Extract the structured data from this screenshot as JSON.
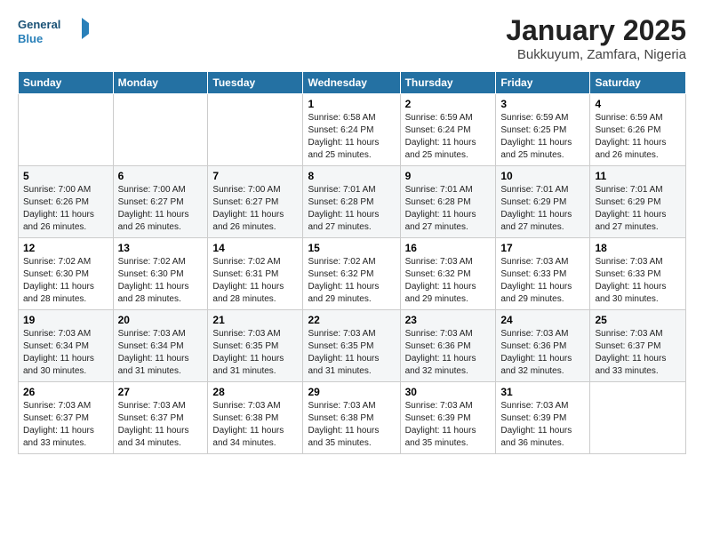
{
  "header": {
    "logo_line1": "General",
    "logo_line2": "Blue",
    "title": "January 2025",
    "subtitle": "Bukkuyum, Zamfara, Nigeria"
  },
  "weekdays": [
    "Sunday",
    "Monday",
    "Tuesday",
    "Wednesday",
    "Thursday",
    "Friday",
    "Saturday"
  ],
  "weeks": [
    [
      {
        "day": "",
        "info": ""
      },
      {
        "day": "",
        "info": ""
      },
      {
        "day": "",
        "info": ""
      },
      {
        "day": "1",
        "info": "Sunrise: 6:58 AM\nSunset: 6:24 PM\nDaylight: 11 hours and 25 minutes."
      },
      {
        "day": "2",
        "info": "Sunrise: 6:59 AM\nSunset: 6:24 PM\nDaylight: 11 hours and 25 minutes."
      },
      {
        "day": "3",
        "info": "Sunrise: 6:59 AM\nSunset: 6:25 PM\nDaylight: 11 hours and 25 minutes."
      },
      {
        "day": "4",
        "info": "Sunrise: 6:59 AM\nSunset: 6:26 PM\nDaylight: 11 hours and 26 minutes."
      }
    ],
    [
      {
        "day": "5",
        "info": "Sunrise: 7:00 AM\nSunset: 6:26 PM\nDaylight: 11 hours and 26 minutes."
      },
      {
        "day": "6",
        "info": "Sunrise: 7:00 AM\nSunset: 6:27 PM\nDaylight: 11 hours and 26 minutes."
      },
      {
        "day": "7",
        "info": "Sunrise: 7:00 AM\nSunset: 6:27 PM\nDaylight: 11 hours and 26 minutes."
      },
      {
        "day": "8",
        "info": "Sunrise: 7:01 AM\nSunset: 6:28 PM\nDaylight: 11 hours and 27 minutes."
      },
      {
        "day": "9",
        "info": "Sunrise: 7:01 AM\nSunset: 6:28 PM\nDaylight: 11 hours and 27 minutes."
      },
      {
        "day": "10",
        "info": "Sunrise: 7:01 AM\nSunset: 6:29 PM\nDaylight: 11 hours and 27 minutes."
      },
      {
        "day": "11",
        "info": "Sunrise: 7:01 AM\nSunset: 6:29 PM\nDaylight: 11 hours and 27 minutes."
      }
    ],
    [
      {
        "day": "12",
        "info": "Sunrise: 7:02 AM\nSunset: 6:30 PM\nDaylight: 11 hours and 28 minutes."
      },
      {
        "day": "13",
        "info": "Sunrise: 7:02 AM\nSunset: 6:30 PM\nDaylight: 11 hours and 28 minutes."
      },
      {
        "day": "14",
        "info": "Sunrise: 7:02 AM\nSunset: 6:31 PM\nDaylight: 11 hours and 28 minutes."
      },
      {
        "day": "15",
        "info": "Sunrise: 7:02 AM\nSunset: 6:32 PM\nDaylight: 11 hours and 29 minutes."
      },
      {
        "day": "16",
        "info": "Sunrise: 7:03 AM\nSunset: 6:32 PM\nDaylight: 11 hours and 29 minutes."
      },
      {
        "day": "17",
        "info": "Sunrise: 7:03 AM\nSunset: 6:33 PM\nDaylight: 11 hours and 29 minutes."
      },
      {
        "day": "18",
        "info": "Sunrise: 7:03 AM\nSunset: 6:33 PM\nDaylight: 11 hours and 30 minutes."
      }
    ],
    [
      {
        "day": "19",
        "info": "Sunrise: 7:03 AM\nSunset: 6:34 PM\nDaylight: 11 hours and 30 minutes."
      },
      {
        "day": "20",
        "info": "Sunrise: 7:03 AM\nSunset: 6:34 PM\nDaylight: 11 hours and 31 minutes."
      },
      {
        "day": "21",
        "info": "Sunrise: 7:03 AM\nSunset: 6:35 PM\nDaylight: 11 hours and 31 minutes."
      },
      {
        "day": "22",
        "info": "Sunrise: 7:03 AM\nSunset: 6:35 PM\nDaylight: 11 hours and 31 minutes."
      },
      {
        "day": "23",
        "info": "Sunrise: 7:03 AM\nSunset: 6:36 PM\nDaylight: 11 hours and 32 minutes."
      },
      {
        "day": "24",
        "info": "Sunrise: 7:03 AM\nSunset: 6:36 PM\nDaylight: 11 hours and 32 minutes."
      },
      {
        "day": "25",
        "info": "Sunrise: 7:03 AM\nSunset: 6:37 PM\nDaylight: 11 hours and 33 minutes."
      }
    ],
    [
      {
        "day": "26",
        "info": "Sunrise: 7:03 AM\nSunset: 6:37 PM\nDaylight: 11 hours and 33 minutes."
      },
      {
        "day": "27",
        "info": "Sunrise: 7:03 AM\nSunset: 6:37 PM\nDaylight: 11 hours and 34 minutes."
      },
      {
        "day": "28",
        "info": "Sunrise: 7:03 AM\nSunset: 6:38 PM\nDaylight: 11 hours and 34 minutes."
      },
      {
        "day": "29",
        "info": "Sunrise: 7:03 AM\nSunset: 6:38 PM\nDaylight: 11 hours and 35 minutes."
      },
      {
        "day": "30",
        "info": "Sunrise: 7:03 AM\nSunset: 6:39 PM\nDaylight: 11 hours and 35 minutes."
      },
      {
        "day": "31",
        "info": "Sunrise: 7:03 AM\nSunset: 6:39 PM\nDaylight: 11 hours and 36 minutes."
      },
      {
        "day": "",
        "info": ""
      }
    ]
  ]
}
